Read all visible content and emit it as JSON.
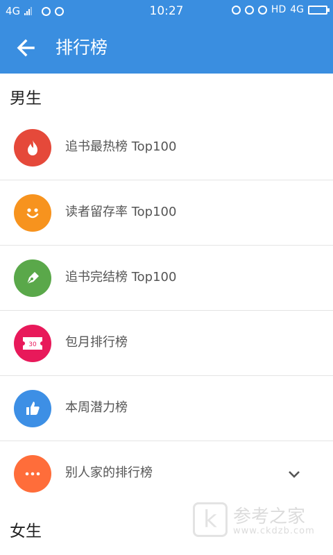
{
  "status_bar": {
    "network": "4G",
    "time": "10:27",
    "hd": "HD",
    "network_right": "4G"
  },
  "header": {
    "title": "排行榜"
  },
  "sections": [
    {
      "title": "男生",
      "items": [
        {
          "label": "追书最热榜 Top100",
          "icon": "flame-icon",
          "color": "#e74c3c"
        },
        {
          "label": "读者留存率 Top100",
          "icon": "smiley-icon",
          "color": "#f39c12"
        },
        {
          "label": "追书完结榜 Top100",
          "icon": "pen-nib-icon",
          "color": "#4caf50"
        },
        {
          "label": "包月排行榜",
          "icon": "ticket-icon",
          "color": "#e91e63",
          "icon_text": "30"
        },
        {
          "label": "本周潜力榜",
          "icon": "thumbs-up-icon",
          "color": "#3d8fe5"
        },
        {
          "label": "别人家的排行榜",
          "icon": "more-icon",
          "color": "#ff6d3a"
        }
      ]
    },
    {
      "title": "女生"
    }
  ],
  "watermark": {
    "logo_letter": "k",
    "text": "参考之家",
    "url": "www.ckdzb.com"
  }
}
